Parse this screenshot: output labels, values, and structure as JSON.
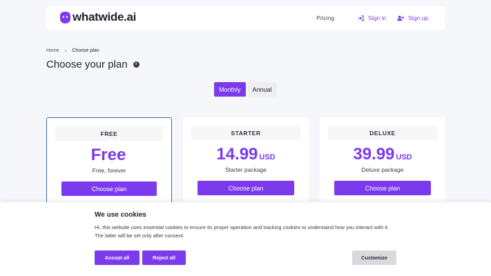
{
  "brand": {
    "name": "whatwide.ai",
    "accent": "#7c3aed"
  },
  "nav": {
    "pricing": "Pricing",
    "sign_in": "Sign in",
    "sign_up": "Sign up"
  },
  "breadcrumb": {
    "home": "Home",
    "current": "Choose plan"
  },
  "page": {
    "title": "Choose your plan",
    "info_icon": "i"
  },
  "billing": {
    "monthly": "Monthly",
    "annual": "Annual",
    "selected": "Monthly"
  },
  "plans": [
    {
      "name": "FREE",
      "price": "Free",
      "currency": "",
      "description": "Free, forever",
      "button": "Choose plan",
      "selected": true
    },
    {
      "name": "STARTER",
      "price": "14.99",
      "currency": "USD",
      "description": "Starter package",
      "button": "Choose plan",
      "selected": false
    },
    {
      "name": "DELUXE",
      "price": "39.99",
      "currency": "USD",
      "description": "Deluxe package",
      "button": "Choose plan",
      "selected": false
    }
  ],
  "cookies": {
    "title": "We use cookies",
    "text": "Hi, this website uses essential cookies to ensure its proper operation and tracking cookies to understand how you interact with it. The latter will be set only after consent.",
    "accept": "Accept all",
    "reject": "Reject all",
    "customize": "Customize"
  }
}
